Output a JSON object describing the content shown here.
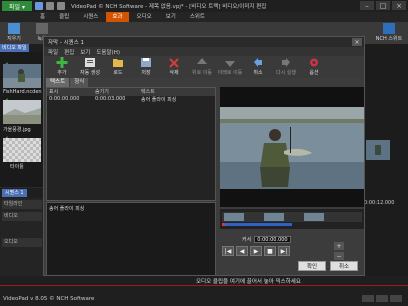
{
  "app": {
    "menu_button": "파일 ▾",
    "title": "VideoPad © NCH Software - 제목 없음.vpj* - [비디오 트랙] 비디오/이미지 편집"
  },
  "ribbon_tabs": [
    "홈",
    "클립",
    "시퀀스",
    "효과",
    "오디오",
    "보기",
    "스위트"
  ],
  "active_ribbon_tab": "효과",
  "main_toolbar": [
    "지우기",
    "녹화",
    "NCH 스위트"
  ],
  "bin_tabs": [
    "비디오 파일"
  ],
  "clips": [
    {
      "label": "FishHard.ncden"
    },
    {
      "label": "가을풍경.jpg"
    },
    {
      "label": "타이틀"
    }
  ],
  "sequence_tabs": [
    "시퀀스 1"
  ],
  "timeline_tracks": [
    "타임라인",
    "비디오",
    "오디오"
  ],
  "dialog": {
    "title": "자막 - 시퀀스 1",
    "close": "×",
    "menu": [
      "파일",
      "편집",
      "보기",
      "도움말(H)"
    ],
    "toolbar": [
      "추가",
      "자동 생성",
      "로드",
      "저장",
      "삭제",
      "위로 이동",
      "아래로 이동",
      "취소",
      "다시 실행",
      "옵션"
    ],
    "tabs": [
      "텍스트",
      "형식"
    ],
    "active_tab": "텍스트",
    "columns": [
      "표시",
      "숨기기",
      "텍스트"
    ],
    "rows": [
      {
        "show": "0:00:00.000",
        "hide": "0:00:03.000",
        "text": "송어 플라이 피싱"
      }
    ],
    "editor_text": "송어 플라이 피싱",
    "cursor_label": "커서",
    "cursor_time": "0:00:00.000",
    "playback": [
      "|◀",
      "◀",
      "▶",
      "■",
      "▶|"
    ],
    "ok": "확인",
    "cancel": "취소"
  },
  "status": {
    "message": "오디오 클립을 여기에 끌어서 놓아 믹스하세요",
    "version": "VideoPad v 8.05 © NCH Software"
  },
  "timeline_timecode": "0:00:12.000",
  "colors": {
    "accent": "#d35400",
    "menu_green": "#2e8b3a",
    "bin_tab_blue": "#4a6fb5"
  }
}
